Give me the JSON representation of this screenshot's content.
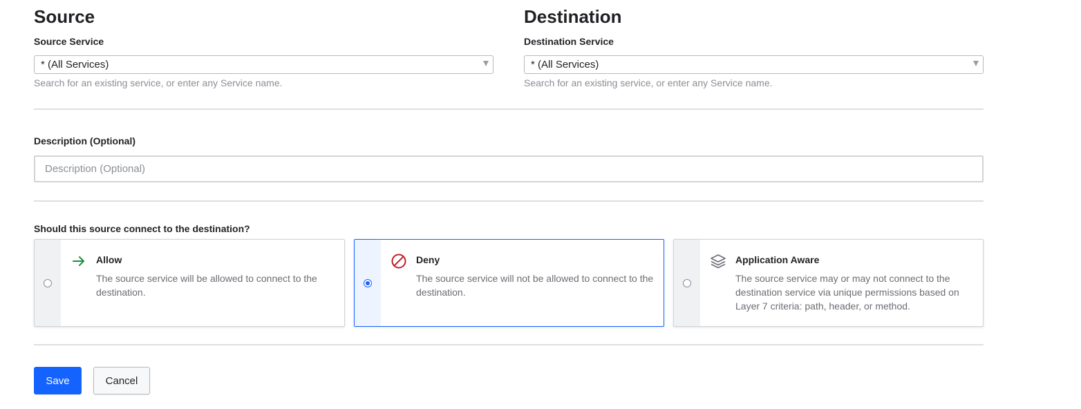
{
  "source": {
    "title": "Source",
    "service_label": "Source Service",
    "service_value": "* (All Services)",
    "help": "Search for an existing service, or enter any Service name."
  },
  "destination": {
    "title": "Destination",
    "service_label": "Destination Service",
    "service_value": "* (All Services)",
    "help": "Search for an existing service, or enter any Service name."
  },
  "description": {
    "label": "Description (Optional)",
    "placeholder": "Description (Optional)",
    "value": ""
  },
  "action": {
    "question": "Should this source connect to the destination?",
    "selected": "deny",
    "options": [
      {
        "id": "allow",
        "icon": "arrow-right-icon",
        "label": "Allow",
        "description": "The source service will be allowed to connect to the destination."
      },
      {
        "id": "deny",
        "icon": "deny-icon",
        "label": "Deny",
        "description": "The source service will not be allowed to connect to the destination."
      },
      {
        "id": "app-aware",
        "icon": "layers-icon",
        "label": "Application Aware",
        "description": "The source service may or may not connect to the destination service via unique permissions based on Layer 7 criteria: path, header, or method."
      }
    ]
  },
  "buttons": {
    "save": "Save",
    "cancel": "Cancel"
  },
  "colors": {
    "primary": "#1563ff",
    "allow": "#1f8c3b",
    "deny": "#c01e26",
    "layers": "#6a6d73"
  }
}
